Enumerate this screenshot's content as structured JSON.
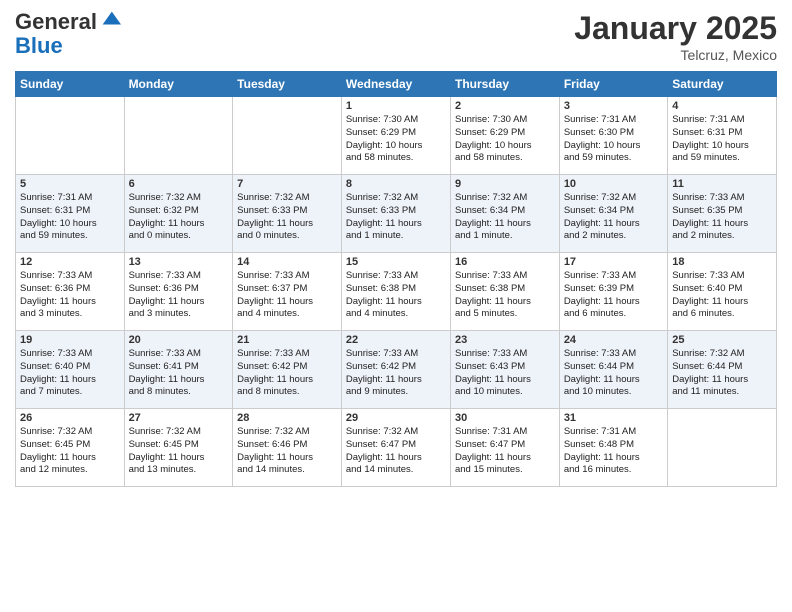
{
  "header": {
    "logo_line1": "General",
    "logo_line2": "Blue",
    "month_title": "January 2025",
    "location": "Telcruz, Mexico"
  },
  "weekdays": [
    "Sunday",
    "Monday",
    "Tuesday",
    "Wednesday",
    "Thursday",
    "Friday",
    "Saturday"
  ],
  "weeks": [
    [
      {
        "day": "",
        "info": ""
      },
      {
        "day": "",
        "info": ""
      },
      {
        "day": "",
        "info": ""
      },
      {
        "day": "1",
        "info": "Sunrise: 7:30 AM\nSunset: 6:29 PM\nDaylight: 10 hours\nand 58 minutes."
      },
      {
        "day": "2",
        "info": "Sunrise: 7:30 AM\nSunset: 6:29 PM\nDaylight: 10 hours\nand 58 minutes."
      },
      {
        "day": "3",
        "info": "Sunrise: 7:31 AM\nSunset: 6:30 PM\nDaylight: 10 hours\nand 59 minutes."
      },
      {
        "day": "4",
        "info": "Sunrise: 7:31 AM\nSunset: 6:31 PM\nDaylight: 10 hours\nand 59 minutes."
      }
    ],
    [
      {
        "day": "5",
        "info": "Sunrise: 7:31 AM\nSunset: 6:31 PM\nDaylight: 10 hours\nand 59 minutes."
      },
      {
        "day": "6",
        "info": "Sunrise: 7:32 AM\nSunset: 6:32 PM\nDaylight: 11 hours\nand 0 minutes."
      },
      {
        "day": "7",
        "info": "Sunrise: 7:32 AM\nSunset: 6:33 PM\nDaylight: 11 hours\nand 0 minutes."
      },
      {
        "day": "8",
        "info": "Sunrise: 7:32 AM\nSunset: 6:33 PM\nDaylight: 11 hours\nand 1 minute."
      },
      {
        "day": "9",
        "info": "Sunrise: 7:32 AM\nSunset: 6:34 PM\nDaylight: 11 hours\nand 1 minute."
      },
      {
        "day": "10",
        "info": "Sunrise: 7:32 AM\nSunset: 6:34 PM\nDaylight: 11 hours\nand 2 minutes."
      },
      {
        "day": "11",
        "info": "Sunrise: 7:33 AM\nSunset: 6:35 PM\nDaylight: 11 hours\nand 2 minutes."
      }
    ],
    [
      {
        "day": "12",
        "info": "Sunrise: 7:33 AM\nSunset: 6:36 PM\nDaylight: 11 hours\nand 3 minutes."
      },
      {
        "day": "13",
        "info": "Sunrise: 7:33 AM\nSunset: 6:36 PM\nDaylight: 11 hours\nand 3 minutes."
      },
      {
        "day": "14",
        "info": "Sunrise: 7:33 AM\nSunset: 6:37 PM\nDaylight: 11 hours\nand 4 minutes."
      },
      {
        "day": "15",
        "info": "Sunrise: 7:33 AM\nSunset: 6:38 PM\nDaylight: 11 hours\nand 4 minutes."
      },
      {
        "day": "16",
        "info": "Sunrise: 7:33 AM\nSunset: 6:38 PM\nDaylight: 11 hours\nand 5 minutes."
      },
      {
        "day": "17",
        "info": "Sunrise: 7:33 AM\nSunset: 6:39 PM\nDaylight: 11 hours\nand 6 minutes."
      },
      {
        "day": "18",
        "info": "Sunrise: 7:33 AM\nSunset: 6:40 PM\nDaylight: 11 hours\nand 6 minutes."
      }
    ],
    [
      {
        "day": "19",
        "info": "Sunrise: 7:33 AM\nSunset: 6:40 PM\nDaylight: 11 hours\nand 7 minutes."
      },
      {
        "day": "20",
        "info": "Sunrise: 7:33 AM\nSunset: 6:41 PM\nDaylight: 11 hours\nand 8 minutes."
      },
      {
        "day": "21",
        "info": "Sunrise: 7:33 AM\nSunset: 6:42 PM\nDaylight: 11 hours\nand 8 minutes."
      },
      {
        "day": "22",
        "info": "Sunrise: 7:33 AM\nSunset: 6:42 PM\nDaylight: 11 hours\nand 9 minutes."
      },
      {
        "day": "23",
        "info": "Sunrise: 7:33 AM\nSunset: 6:43 PM\nDaylight: 11 hours\nand 10 minutes."
      },
      {
        "day": "24",
        "info": "Sunrise: 7:33 AM\nSunset: 6:44 PM\nDaylight: 11 hours\nand 10 minutes."
      },
      {
        "day": "25",
        "info": "Sunrise: 7:32 AM\nSunset: 6:44 PM\nDaylight: 11 hours\nand 11 minutes."
      }
    ],
    [
      {
        "day": "26",
        "info": "Sunrise: 7:32 AM\nSunset: 6:45 PM\nDaylight: 11 hours\nand 12 minutes."
      },
      {
        "day": "27",
        "info": "Sunrise: 7:32 AM\nSunset: 6:45 PM\nDaylight: 11 hours\nand 13 minutes."
      },
      {
        "day": "28",
        "info": "Sunrise: 7:32 AM\nSunset: 6:46 PM\nDaylight: 11 hours\nand 14 minutes."
      },
      {
        "day": "29",
        "info": "Sunrise: 7:32 AM\nSunset: 6:47 PM\nDaylight: 11 hours\nand 14 minutes."
      },
      {
        "day": "30",
        "info": "Sunrise: 7:31 AM\nSunset: 6:47 PM\nDaylight: 11 hours\nand 15 minutes."
      },
      {
        "day": "31",
        "info": "Sunrise: 7:31 AM\nSunset: 6:48 PM\nDaylight: 11 hours\nand 16 minutes."
      },
      {
        "day": "",
        "info": ""
      }
    ]
  ]
}
